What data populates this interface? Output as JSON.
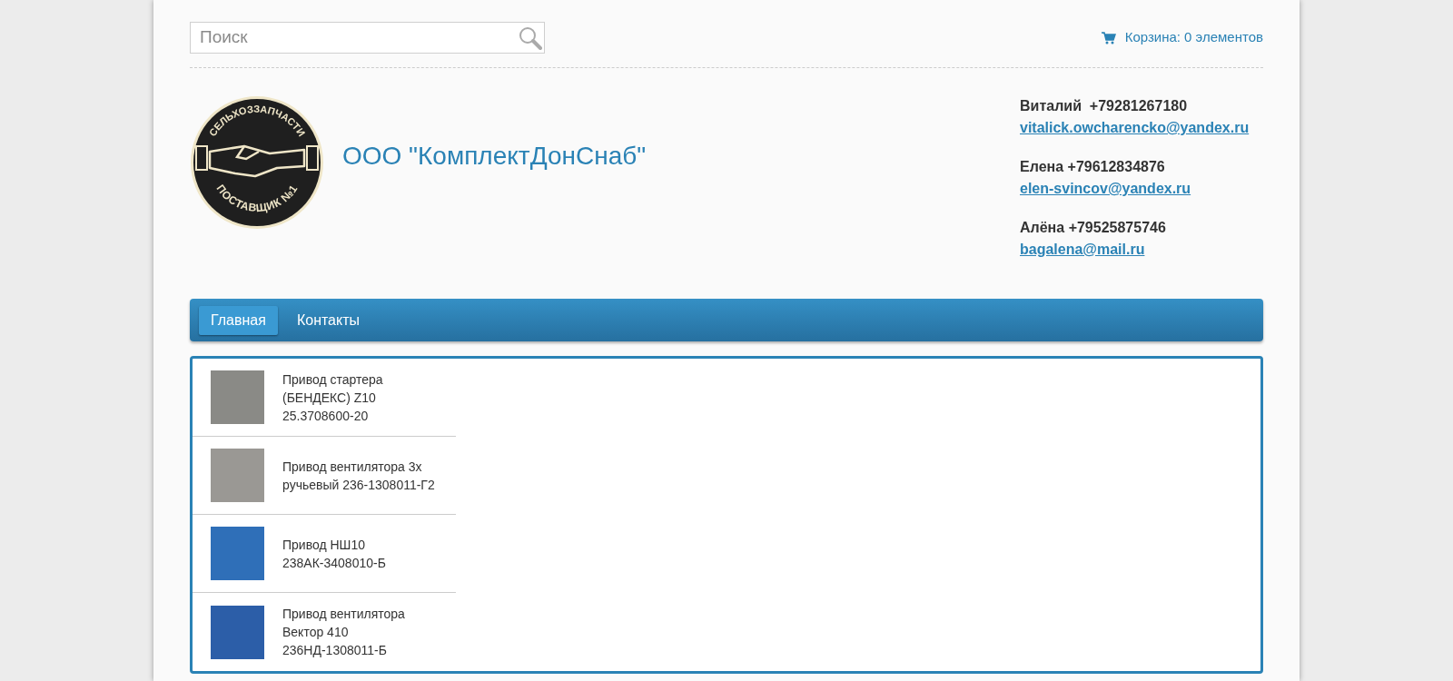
{
  "search": {
    "placeholder": "Поиск"
  },
  "cart": {
    "label": "Корзина: 0 элементов"
  },
  "logo": {
    "top_text": "СЕЛЬХОЗЗАПЧАСТИ",
    "bottom_text": "ПОСТАВЩИК №1"
  },
  "company_name": "ООО \"КомплектДонСнаб\"",
  "contacts": [
    {
      "name": "Виталий  +79281267180",
      "email": "vitalick.owcharencko@yandex.ru"
    },
    {
      "name": "Елена +79612834876",
      "email": "elen-svincov@yandex.ru"
    },
    {
      "name": "Алёна +79525875746",
      "email": "bagalena@mail.ru"
    }
  ],
  "nav": [
    {
      "label": "Главная",
      "selected": true
    },
    {
      "label": "Контакты",
      "selected": false
    }
  ],
  "products": [
    {
      "title": "Привод стартера (БЕНДЕКС) Z10 25.3708600-20"
    },
    {
      "title": "Привод вентилятора 3х ручьевый 236-1308011-Г2"
    },
    {
      "title": "Привод НШ10 238АК-3408010-Б"
    },
    {
      "title": "Привод вентилятора Вектор 410 236НД-1308011-Б"
    }
  ]
}
